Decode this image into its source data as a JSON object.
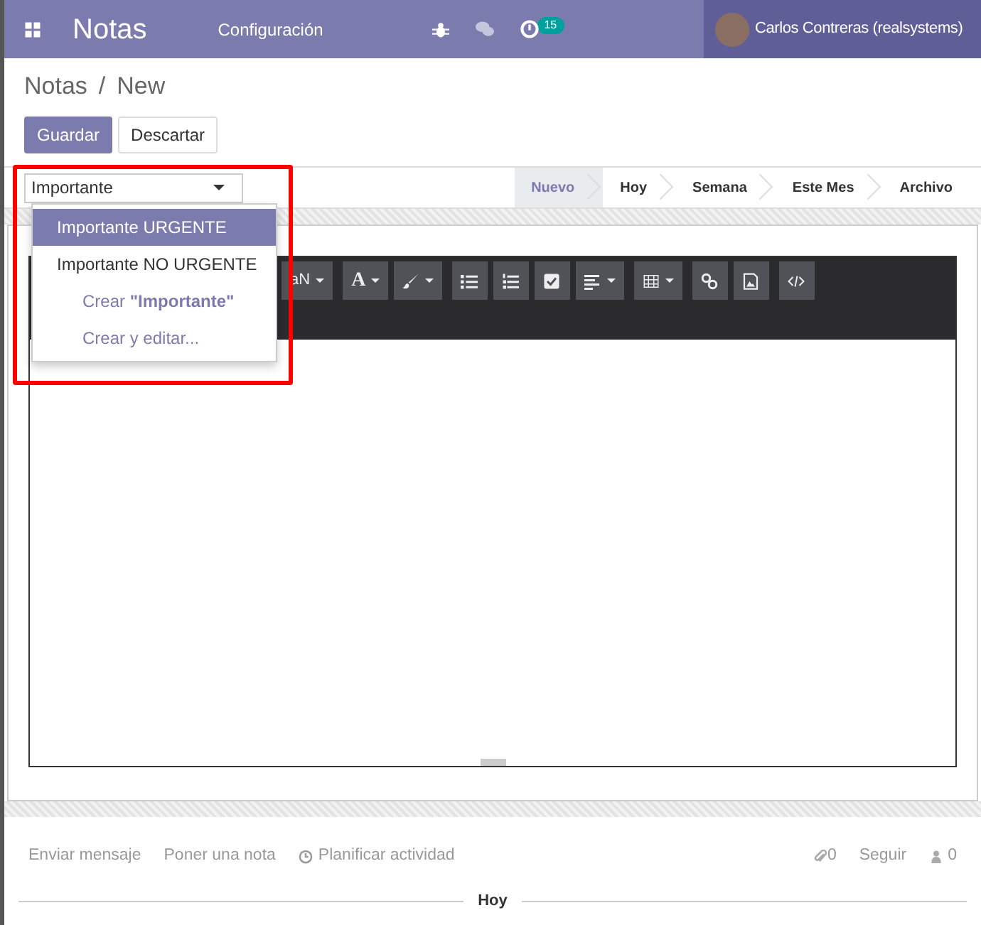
{
  "navbar": {
    "app_title": "Notas",
    "menu": [
      "Configuración"
    ],
    "activity_count": "15",
    "user": "Carlos Contreras (realsystems)"
  },
  "breadcrumb": [
    "Notas",
    "New"
  ],
  "breadcrumb_separator": "/",
  "buttons": [
    {
      "label": "Guardar",
      "kind": "primary"
    },
    {
      "label": "Descartar",
      "kind": "secondary"
    }
  ],
  "tag_field": {
    "value": "Importante"
  },
  "dropdown": [
    {
      "label": "Importante URGENTE",
      "kind": "option",
      "selected": true
    },
    {
      "label": "Importante NO URGENTE",
      "kind": "option",
      "selected": false
    },
    {
      "label": "Crear **\"Importante\"**",
      "kind": "action",
      "selected": false
    },
    {
      "label": "Crear y editar...",
      "kind": "action",
      "selected": false
    }
  ],
  "stages": [
    {
      "label": "Nuevo",
      "selected": true
    },
    {
      "label": "Hoy",
      "selected": false
    },
    {
      "label": "Semana",
      "selected": false
    },
    {
      "label": "Este Mes",
      "selected": false
    },
    {
      "label": "Archivo",
      "selected": false
    }
  ],
  "toolbar": {
    "font_size": "aN",
    "font_color": "A"
  },
  "chatter": {
    "actions": [
      "Enviar mensaje",
      "Poner una nota",
      "Planificar actividad"
    ],
    "attachments": "0",
    "follow": "Seguir",
    "followers": "0",
    "separator": "Hoy"
  }
}
